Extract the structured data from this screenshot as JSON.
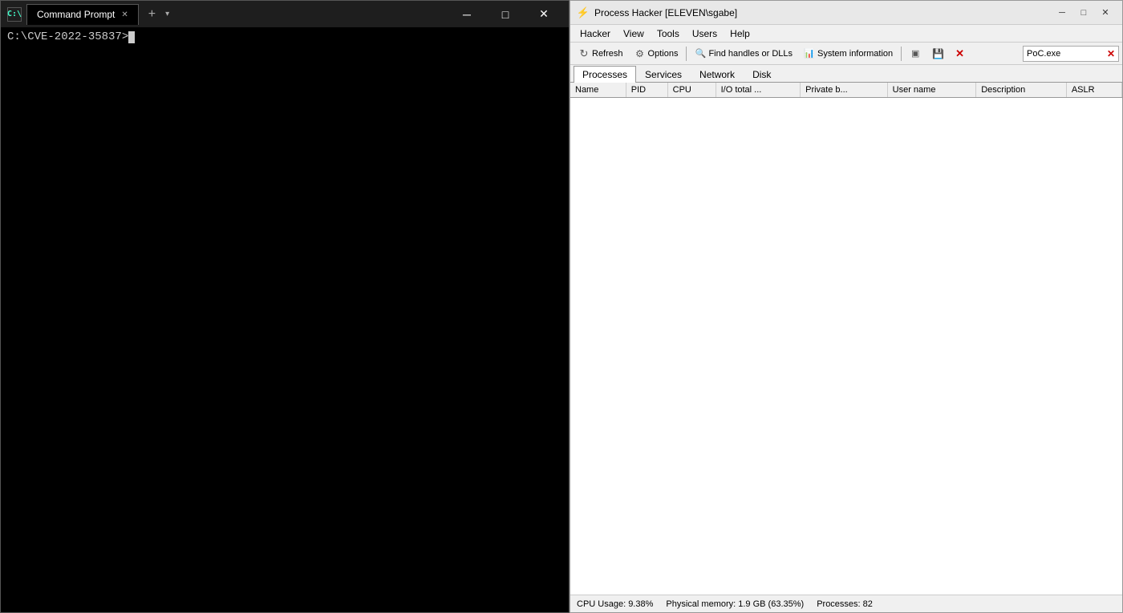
{
  "cmd": {
    "title": "Command Prompt",
    "icon": "C:",
    "tab_label": "Command Prompt",
    "prompt_text": "C:\\CVE-2022-35837>",
    "controls": {
      "minimize": "─",
      "maximize": "□",
      "close": "✕"
    }
  },
  "ph": {
    "title": "Process Hacker [ELEVEN\\sgabe]",
    "controls": {
      "minimize": "─",
      "maximize": "□",
      "close": "✕"
    },
    "menubar": {
      "items": [
        "Hacker",
        "View",
        "Tools",
        "Users",
        "Help"
      ]
    },
    "toolbar": {
      "refresh": "Refresh",
      "options": "Options",
      "find": "Find handles or DLLs",
      "sysinfo": "System information",
      "search_placeholder": "PoC.exe"
    },
    "tabs": {
      "items": [
        "Processes",
        "Services",
        "Network",
        "Disk"
      ],
      "active": "Processes"
    },
    "table": {
      "columns": [
        "Name",
        "PID",
        "CPU",
        "I/O total ...",
        "Private b...",
        "User name",
        "Description",
        "ASLR"
      ],
      "rows": []
    },
    "statusbar": {
      "cpu": "CPU Usage: 9.38%",
      "memory": "Physical memory: 1.9 GB (63.35%)",
      "processes": "Processes: 82"
    }
  }
}
